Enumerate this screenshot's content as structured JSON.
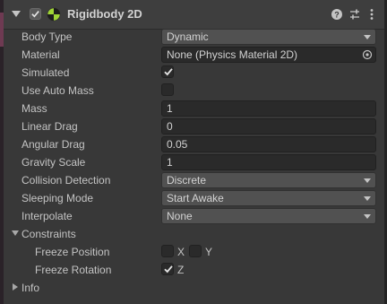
{
  "component": {
    "title": "Rigidbody 2D",
    "enabled": true,
    "icon": "rigidbody2d-icon",
    "header_buttons": [
      "help-icon",
      "preset-icon",
      "kebab-menu-icon"
    ]
  },
  "properties": {
    "body_type": {
      "label": "Body Type",
      "value": "Dynamic"
    },
    "material": {
      "label": "Material",
      "value": "None (Physics Material 2D)"
    },
    "simulated": {
      "label": "Simulated",
      "checked": true
    },
    "use_auto_mass": {
      "label": "Use Auto Mass",
      "checked": false
    },
    "mass": {
      "label": "Mass",
      "value": "1"
    },
    "linear_drag": {
      "label": "Linear Drag",
      "value": "0"
    },
    "angular_drag": {
      "label": "Angular Drag",
      "value": "0.05"
    },
    "gravity_scale": {
      "label": "Gravity Scale",
      "value": "1"
    },
    "collision_detection": {
      "label": "Collision Detection",
      "value": "Discrete"
    },
    "sleeping_mode": {
      "label": "Sleeping Mode",
      "value": "Start Awake"
    },
    "interpolate": {
      "label": "Interpolate",
      "value": "None"
    }
  },
  "constraints": {
    "label": "Constraints",
    "expanded": true,
    "freeze_position": {
      "label": "Freeze Position",
      "x_label": "X",
      "x_checked": false,
      "y_label": "Y",
      "y_checked": false
    },
    "freeze_rotation": {
      "label": "Freeze Rotation",
      "z_label": "Z",
      "z_checked": true
    }
  },
  "info": {
    "label": "Info",
    "expanded": false
  },
  "colors": {
    "panel_bg": "#383838",
    "header_bg": "#3e3e3e",
    "text": "#c4c4c4",
    "field_bg": "#2a2a2a",
    "dropdown_bg": "#515151"
  }
}
